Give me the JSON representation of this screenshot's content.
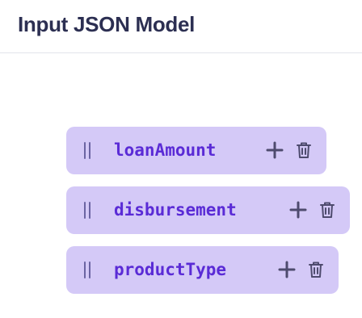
{
  "header": {
    "title": "Input JSON Model"
  },
  "fields": [
    {
      "label": "loanAmount"
    },
    {
      "label": "disbursement"
    },
    {
      "label": "productType"
    }
  ],
  "colors": {
    "field_bg": "#d4c9f7",
    "field_text": "#5a2bd6",
    "title_text": "#2c2f52",
    "icon": "#4e4b6e"
  },
  "icons": {
    "drag": "drag-handle-icon",
    "add": "plus-icon",
    "delete": "trash-icon"
  }
}
